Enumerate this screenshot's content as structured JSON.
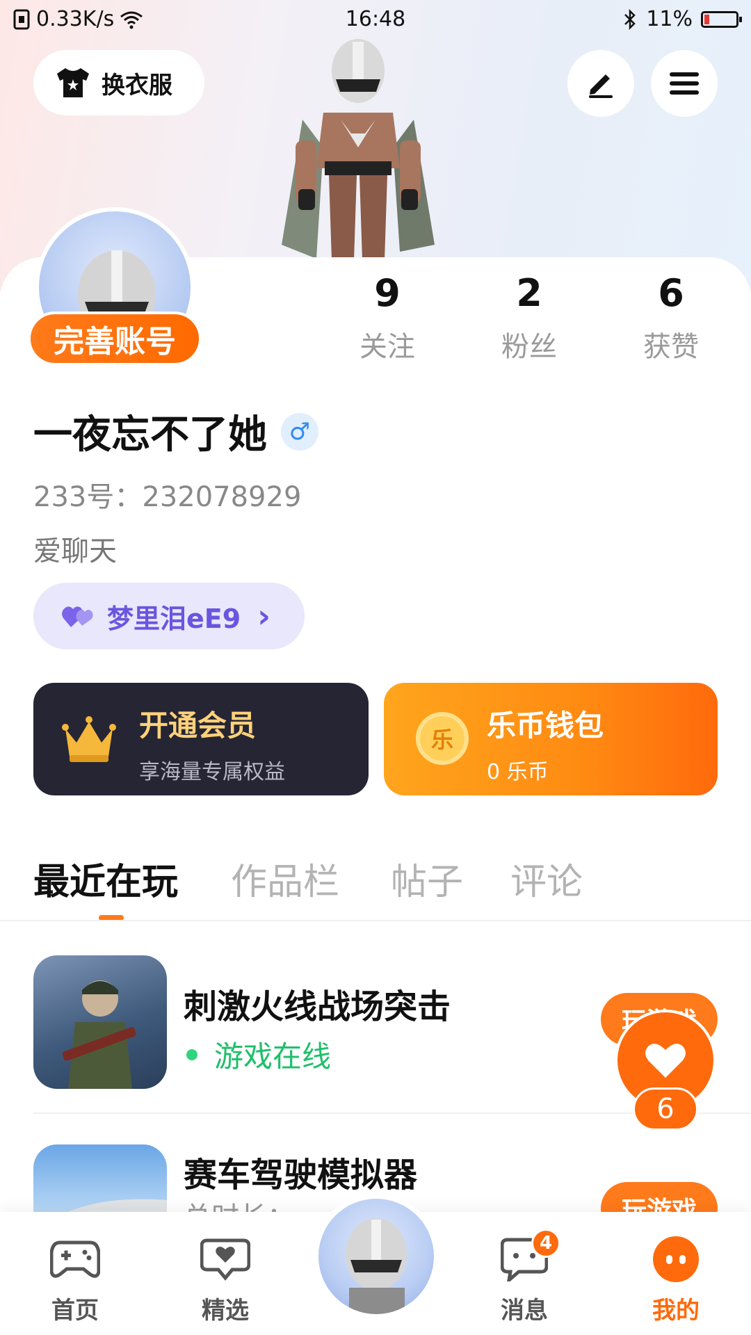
{
  "status_bar": {
    "speed": "0.33K/s",
    "time": "16:48",
    "battery": "11%"
  },
  "header": {
    "outfit_label": "换衣服",
    "edit_icon": "edit-icon",
    "menu_icon": "menu-icon"
  },
  "profile": {
    "complete_account_label": "完善账号",
    "stats": [
      {
        "value": "9",
        "label": "关注"
      },
      {
        "value": "2",
        "label": "粉丝"
      },
      {
        "value": "6",
        "label": "获赞"
      }
    ],
    "nickname": "一夜忘不了她",
    "gender_symbol": "♂",
    "uid": "233号：232078929",
    "bio": "爱聊天",
    "guild_name": "梦里泪eE9",
    "guild_chevron": "›"
  },
  "promos": {
    "vip": {
      "title": "开通会员",
      "subtitle": "享海量专属权益",
      "icon": "crown-icon"
    },
    "wallet": {
      "title": "乐币钱包",
      "subtitle": "0 乐币",
      "coin_char": "乐",
      "icon": "coin-icon"
    }
  },
  "tabs": [
    {
      "label": "最近在玩",
      "active": true
    },
    {
      "label": "作品栏",
      "active": false
    },
    {
      "label": "帖子",
      "active": false
    },
    {
      "label": "评论",
      "active": false
    }
  ],
  "games": [
    {
      "title": "刺激火线战场突击",
      "status": "游戏在线",
      "button": "玩游戏"
    },
    {
      "title": "赛车驾驶模拟器",
      "status": "总时长：",
      "button": "玩游戏"
    }
  ],
  "like_fab": {
    "count": "6"
  },
  "bottom_nav": [
    {
      "label": "首页",
      "icon": "gamepad-icon"
    },
    {
      "label": "精选",
      "icon": "heart-chat-icon"
    },
    {
      "label": "",
      "icon": "avatar-center"
    },
    {
      "label": "消息",
      "icon": "message-icon",
      "badge": "4"
    },
    {
      "label": "我的",
      "icon": "profile-face-icon"
    }
  ],
  "colors": {
    "accent": "#ff7a1a",
    "vip_bg": "#262534",
    "vip_gold": "#ffd27a",
    "online_green": "#1fbf6a",
    "guild_purple": "#6a55df"
  }
}
